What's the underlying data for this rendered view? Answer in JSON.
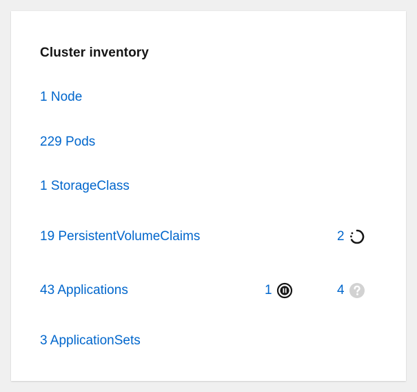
{
  "card": {
    "title": "Cluster inventory"
  },
  "rows": [
    {
      "label": "1 Node"
    },
    {
      "label": "229 Pods"
    },
    {
      "label": "1 StorageClass"
    },
    {
      "label": "19 PersistentVolumeClaims",
      "statuses": [
        {
          "count": "2",
          "icon": "progress-spinner-icon"
        }
      ]
    },
    {
      "label": "43 Applications",
      "statuses": [
        {
          "count": "1",
          "icon": "paused-icon"
        },
        {
          "count": "4",
          "icon": "unknown-question-icon"
        }
      ]
    },
    {
      "label": "3 ApplicationSets"
    }
  ],
  "colors": {
    "link": "#0066cc",
    "title": "#151515",
    "icon_dark": "#151515",
    "icon_muted": "#d2d2d2"
  }
}
